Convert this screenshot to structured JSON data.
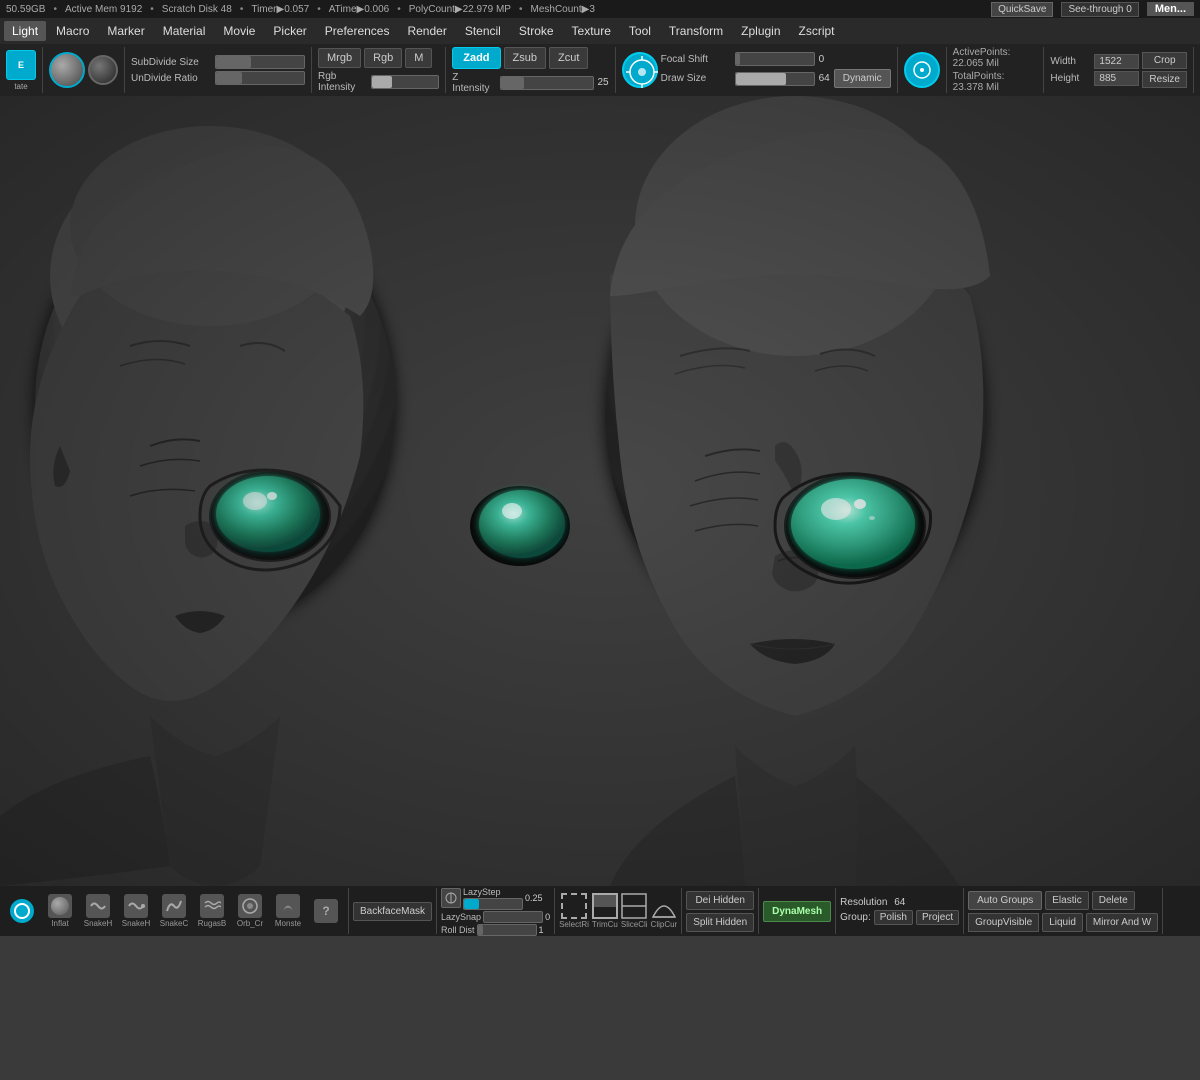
{
  "statusBar": {
    "storage": "50.59GB",
    "activeMem": "Active Mem 9192",
    "scratchDisk": "Scratch Disk 48",
    "timer": "Timer▶0.057",
    "atime": "ATime▶0.006",
    "polyCount": "PolyCount▶22.979 MP",
    "meshCount": "MeshCount▶3",
    "quicksave": "QuickSave",
    "seethrough": "See-through  0",
    "menu": "Men..."
  },
  "menuBar": {
    "items": [
      "Light",
      "Macro",
      "Marker",
      "Material",
      "Movie",
      "Picker",
      "Preferences",
      "Render",
      "Stencil",
      "Stroke",
      "Texture",
      "Tool",
      "Transform",
      "Zplugin",
      "Zscript"
    ]
  },
  "toolbar": {
    "subdivide_label": "SubDivide Size",
    "undivide_label": "UnDivide Ratio",
    "mrgb_label": "Mrgb",
    "rgb_label": "Rgb",
    "m_label": "M",
    "zadd_label": "Zadd",
    "zsub_label": "Zsub",
    "zcut_label": "Zcut",
    "z_intensity_label": "Z Intensity",
    "z_intensity_value": "25",
    "rgb_intensity_label": "Rgb Intensity",
    "focal_shift_label": "Focal Shift",
    "focal_shift_value": "0",
    "draw_size_label": "Draw Size",
    "draw_size_value": "64",
    "dynamic_label": "Dynamic",
    "active_points_label": "ActivePoints:",
    "active_points_value": "22.065 Mil",
    "total_points_label": "TotalPoints:",
    "total_points_value": "23.378 Mil",
    "width_label": "Width",
    "width_value": "1522",
    "height_label": "Height",
    "height_value": "885",
    "crop_label": "Crop",
    "resize_label": "Resize"
  },
  "bottomBar": {
    "tools": [
      {
        "id": "tool0",
        "label": ""
      },
      {
        "id": "tool1",
        "label": "Inflat"
      },
      {
        "id": "tool2",
        "label": "SnakeH"
      },
      {
        "id": "tool3",
        "label": "SnakeH"
      },
      {
        "id": "tool4",
        "label": "SnakeC"
      },
      {
        "id": "tool5",
        "label": "RugasB"
      },
      {
        "id": "tool6",
        "label": "Orb_Cr"
      },
      {
        "id": "tool7",
        "label": "Monste"
      },
      {
        "id": "tool8",
        "label": "?"
      }
    ],
    "backfacemask_label": "BackfaceMask",
    "lazystep_label": "LazyStep",
    "lazystep_value": "0.25",
    "lazysnap_label": "LazySnap",
    "lazysnap_value": "0",
    "rolldist_label": "Roll Dist",
    "rolldist_value": "1",
    "selectri_label": "SelectRi",
    "trimcu_label": "TrimCu",
    "slicecli_label": "SliceCli",
    "clipcur_label": "ClipCur",
    "dei_hidden_label": "Dei Hidden",
    "split_hidden_label": "Split Hidden",
    "dynaesh_label": "DynaMesh",
    "resolution_label": "Resolution",
    "resolution_value": "64",
    "group_label": "Group:",
    "polish_label": "Polish",
    "project_label": "Project",
    "auto_groups_label": "Auto Groups",
    "elastic_label": "Elastic",
    "delete_label": "Delete",
    "group_visible_label": "GroupVisible",
    "liquid_label": "Liquid",
    "mirror_label": "Mirror And W"
  },
  "scene": {
    "description": "Two alien head sculptures with glowing teal eyes on dark gray background"
  }
}
